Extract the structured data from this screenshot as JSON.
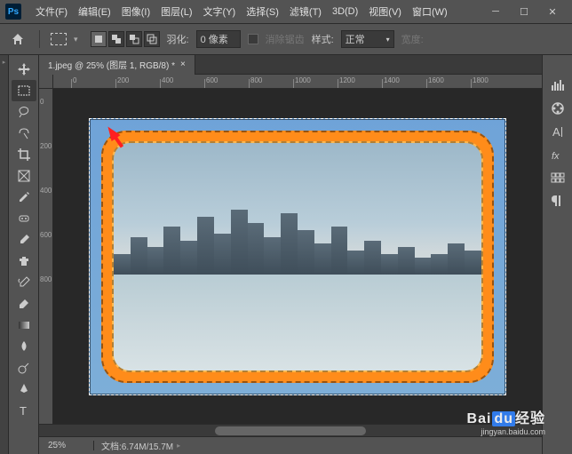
{
  "menu": [
    "文件(F)",
    "编辑(E)",
    "图像(I)",
    "图层(L)",
    "文字(Y)",
    "选择(S)",
    "滤镜(T)",
    "3D(D)",
    "视图(V)",
    "窗口(W)"
  ],
  "options": {
    "feather_label": "羽化:",
    "feather_value": "0 像素",
    "antialias": "消除锯齿",
    "style_label": "样式:",
    "style_value": "正常",
    "width_label": "宽度:"
  },
  "document": {
    "tab_title": "1.jpeg @ 25% (图层 1, RGB/8) *",
    "zoom": "25%",
    "doc_size": "文档:6.74M/15.7M"
  },
  "ruler_h": [
    "0",
    "200",
    "400",
    "600",
    "800",
    "1000",
    "1200",
    "1400",
    "1600",
    "1800"
  ],
  "ruler_v": [
    "0",
    "200",
    "400",
    "600",
    "800"
  ],
  "watermark": {
    "brand1": "Bai",
    "brand2": "du",
    "brand3": "经验",
    "url": "jingyan.baidu.com"
  },
  "tools": [
    "move",
    "rect-marquee",
    "lasso",
    "quick-select",
    "crop",
    "frame",
    "eyedropper",
    "heal",
    "brush",
    "clone",
    "history-brush",
    "eraser",
    "gradient",
    "blur",
    "dodge",
    "pen",
    "type",
    "path-select",
    "rectangle",
    "hand",
    "zoom"
  ],
  "panels": [
    "histogram",
    "color",
    "character",
    "styles",
    "adjustments",
    "paragraph"
  ]
}
